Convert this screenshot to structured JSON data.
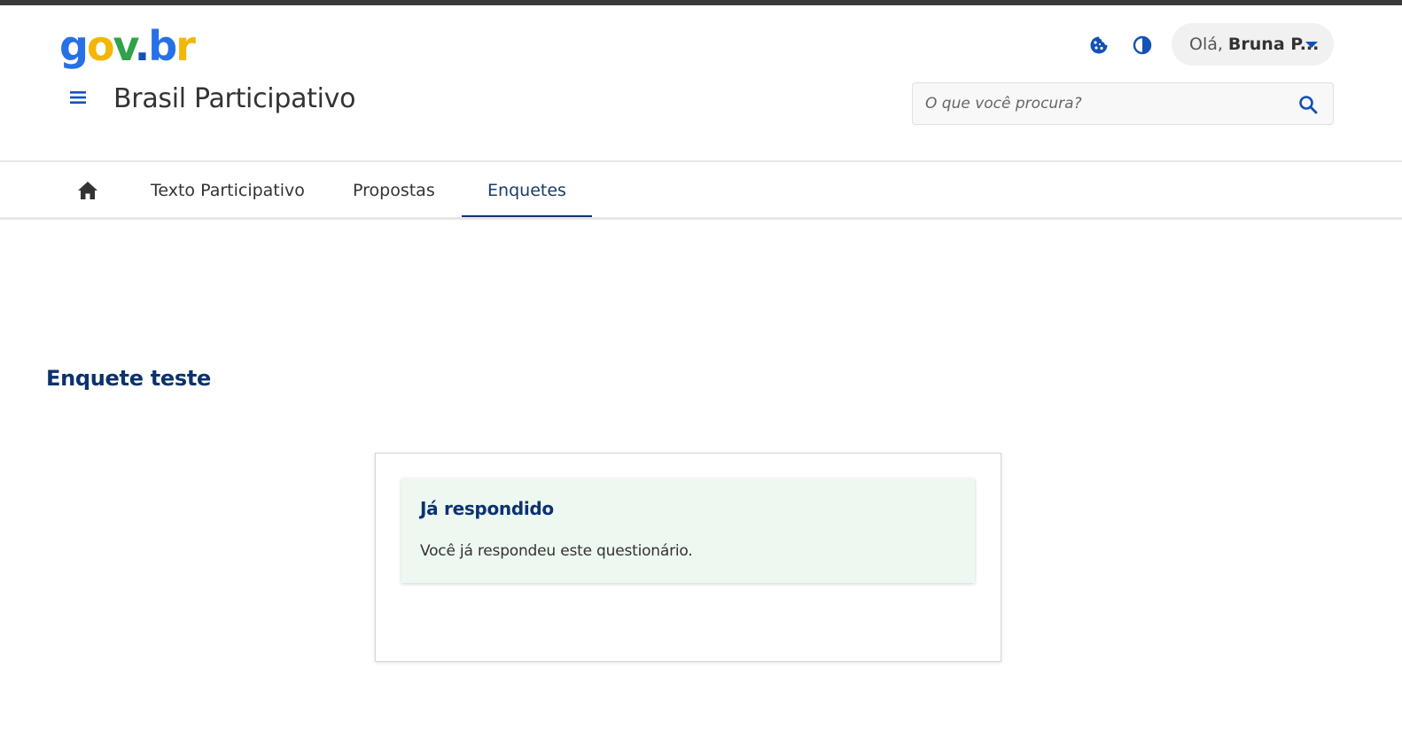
{
  "header": {
    "logo": {
      "g": "g",
      "o": "o",
      "v": "v",
      "dot": ".",
      "b": "b",
      "r": "r"
    },
    "site_title": "Brasil Participativo",
    "user": {
      "greeting": "Olá,",
      "name": "Bruna P..."
    },
    "search": {
      "placeholder": "O que você procura?"
    },
    "icons": {
      "menu": "hamburger-icon",
      "cookie": "cookie-icon",
      "contrast": "contrast-icon",
      "search": "search-icon",
      "dropdown": "caret-down-icon"
    }
  },
  "nav": {
    "home_icon": "home-icon",
    "tabs": [
      {
        "label": "Texto Participativo"
      },
      {
        "label": "Propostas"
      },
      {
        "label": "Enquetes",
        "active": true
      }
    ]
  },
  "main": {
    "title": "Enquete teste",
    "alert": {
      "title": "Já respondido",
      "message": "Você já respondeu este questionário."
    }
  },
  "colors": {
    "primary": "#1351b4",
    "title_blue": "#0c326f",
    "alert_bg": "#edf8f0"
  }
}
